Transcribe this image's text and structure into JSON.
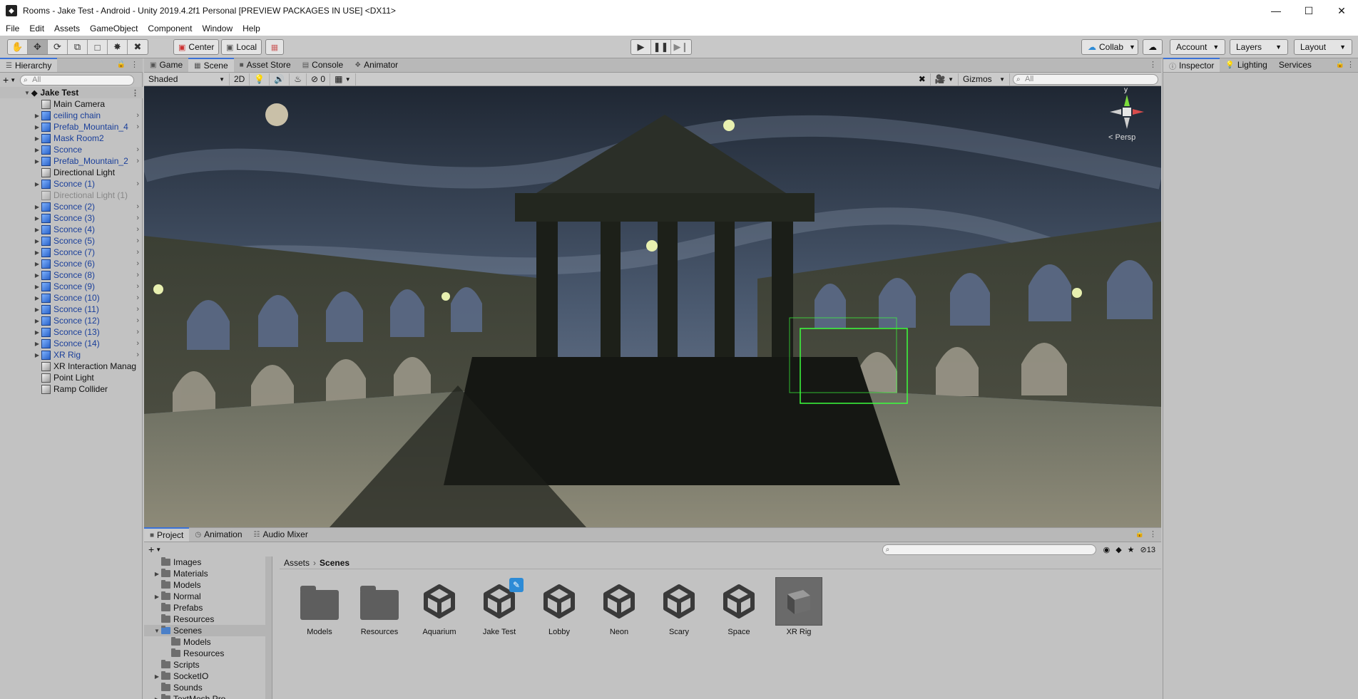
{
  "window": {
    "title": "Rooms - Jake Test - Android - Unity 2019.4.2f1 Personal [PREVIEW PACKAGES IN USE] <DX11>",
    "minimize": "—",
    "maximize": "☐",
    "close": "✕"
  },
  "menu": [
    "File",
    "Edit",
    "Assets",
    "GameObject",
    "Component",
    "Window",
    "Help"
  ],
  "toolbar": {
    "pivot_label": "Center",
    "space_label": "Local",
    "collab_label": "Collab",
    "account_label": "Account",
    "layers_label": "Layers",
    "layout_label": "Layout"
  },
  "hierarchy": {
    "tab_label": "Hierarchy",
    "add_label": "+",
    "search_placeholder": "All",
    "scene_name": "Jake Test",
    "items": [
      {
        "label": "Main Camera",
        "type": "gray",
        "expand": false,
        "more": false
      },
      {
        "label": "ceiling chain",
        "type": "prefab",
        "expand": true,
        "more": true
      },
      {
        "label": "Prefab_Mountain_4",
        "type": "prefab",
        "expand": true,
        "more": true
      },
      {
        "label": "Mask Room2",
        "type": "prefab",
        "expand": true,
        "more": false
      },
      {
        "label": "Sconce",
        "type": "prefab",
        "expand": true,
        "more": true
      },
      {
        "label": "Prefab_Mountain_2",
        "type": "prefab",
        "expand": true,
        "more": true
      },
      {
        "label": "Directional Light",
        "type": "gray",
        "expand": false,
        "more": false
      },
      {
        "label": "Sconce (1)",
        "type": "prefab",
        "expand": true,
        "more": true
      },
      {
        "label": "Directional Light (1)",
        "type": "disabled",
        "expand": false,
        "more": false
      },
      {
        "label": "Sconce (2)",
        "type": "prefab",
        "expand": true,
        "more": true
      },
      {
        "label": "Sconce (3)",
        "type": "prefab",
        "expand": true,
        "more": true
      },
      {
        "label": "Sconce (4)",
        "type": "prefab",
        "expand": true,
        "more": true
      },
      {
        "label": "Sconce (5)",
        "type": "prefab",
        "expand": true,
        "more": true
      },
      {
        "label": "Sconce (7)",
        "type": "prefab",
        "expand": true,
        "more": true
      },
      {
        "label": "Sconce (6)",
        "type": "prefab",
        "expand": true,
        "more": true
      },
      {
        "label": "Sconce (8)",
        "type": "prefab",
        "expand": true,
        "more": true
      },
      {
        "label": "Sconce (9)",
        "type": "prefab",
        "expand": true,
        "more": true
      },
      {
        "label": "Sconce (10)",
        "type": "prefab",
        "expand": true,
        "more": true
      },
      {
        "label": "Sconce (11)",
        "type": "prefab",
        "expand": true,
        "more": true
      },
      {
        "label": "Sconce (12)",
        "type": "prefab",
        "expand": true,
        "more": true
      },
      {
        "label": "Sconce (13)",
        "type": "prefab",
        "expand": true,
        "more": true
      },
      {
        "label": "Sconce (14)",
        "type": "prefab",
        "expand": true,
        "more": true
      },
      {
        "label": "XR Rig",
        "type": "prefab",
        "expand": true,
        "more": true
      },
      {
        "label": "XR Interaction Manag",
        "type": "gray",
        "expand": false,
        "more": false
      },
      {
        "label": "Point Light",
        "type": "gray",
        "expand": false,
        "more": false
      },
      {
        "label": "Ramp Collider",
        "type": "gray",
        "expand": false,
        "more": false
      }
    ]
  },
  "center_tabs": [
    "Game",
    "Scene",
    "Asset Store",
    "Console",
    "Animator"
  ],
  "scene_toolbar": {
    "shading": "Shaded",
    "mode_2d": "2D",
    "hidden_count": "0",
    "gizmos": "Gizmos",
    "search_placeholder": "All",
    "persp": "Persp",
    "axis_y": "y"
  },
  "right_tabs": [
    "Inspector",
    "Lighting",
    "Services"
  ],
  "project": {
    "tabs": [
      "Project",
      "Animation",
      "Audio Mixer"
    ],
    "add_label": "+",
    "hidden_count": "13",
    "tree": [
      {
        "label": "Images",
        "indent": 1,
        "expand": false,
        "selected": false
      },
      {
        "label": "Materials",
        "indent": 1,
        "expand": true,
        "selected": false
      },
      {
        "label": "Models",
        "indent": 1,
        "expand": false,
        "selected": false
      },
      {
        "label": "Normal",
        "indent": 1,
        "expand": true,
        "selected": false
      },
      {
        "label": "Prefabs",
        "indent": 1,
        "expand": false,
        "selected": false
      },
      {
        "label": "Resources",
        "indent": 1,
        "expand": false,
        "selected": false
      },
      {
        "label": "Scenes",
        "indent": 1,
        "expand": true,
        "selected": true,
        "open": true
      },
      {
        "label": "Models",
        "indent": 2,
        "expand": false,
        "selected": false
      },
      {
        "label": "Resources",
        "indent": 2,
        "expand": false,
        "selected": false
      },
      {
        "label": "Scripts",
        "indent": 1,
        "expand": false,
        "selected": false
      },
      {
        "label": "SocketIO",
        "indent": 1,
        "expand": true,
        "selected": false
      },
      {
        "label": "Sounds",
        "indent": 1,
        "expand": false,
        "selected": false
      },
      {
        "label": "TextMesh Pro",
        "indent": 1,
        "expand": true,
        "selected": false
      }
    ],
    "breadcrumb": {
      "root": "Assets",
      "current": "Scenes"
    },
    "assets": [
      {
        "name": "Models",
        "kind": "folder"
      },
      {
        "name": "Resources",
        "kind": "folder"
      },
      {
        "name": "Aquarium",
        "kind": "scene"
      },
      {
        "name": "Jake Test",
        "kind": "scene",
        "edited": true
      },
      {
        "name": "Lobby",
        "kind": "scene"
      },
      {
        "name": "Neon",
        "kind": "scene"
      },
      {
        "name": "Scary",
        "kind": "scene"
      },
      {
        "name": "Space",
        "kind": "scene"
      },
      {
        "name": "XR Rig",
        "kind": "prefab"
      }
    ]
  },
  "colors": {
    "accent": "#3a72d8",
    "prefab_text": "#1a3f9a",
    "selection_box": "#3cff3c"
  }
}
